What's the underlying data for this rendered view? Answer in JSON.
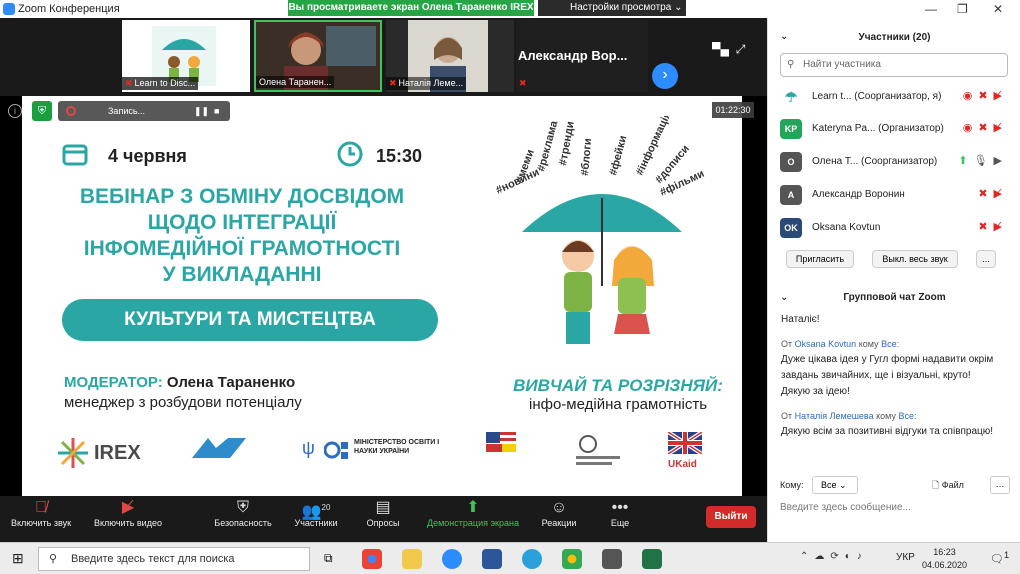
{
  "window": {
    "title": "Zoom Конференция"
  },
  "share_banner": "Вы просматриваете экран  Олена Тараненко IREX",
  "view_options": "Настройки просмотра",
  "gallery": [
    {
      "name": "Learn to Disc..."
    },
    {
      "name": "Олена Таранен..."
    },
    {
      "name": "Наталія Лемe..."
    },
    {
      "name": "Александр  Вор..."
    }
  ],
  "recording": {
    "label": "Запись...",
    "time": "01:22:30"
  },
  "slide": {
    "date": "4 червня",
    "time": "15:30",
    "title_lines": [
      "ВЕБІНАР З ОБМІНУ ДОСВІДОМ",
      "ЩОДО ІНТЕГРАЦІЇ",
      "ІНФОМЕДІЙНОЇ ГРАМОТНОСТІ",
      "У ВИКЛАДАННІ"
    ],
    "pill": "КУЛЬТУРИ ТА МИСТЕЦТВА",
    "moderator_label": "МОДЕРАТОР:",
    "moderator_name": "Олена Тараненко",
    "moderator_role": "менеджер з розбудови потенціалу",
    "slogan_1": "ВИВЧАЙ ТА РОЗРІЗНЯЙ:",
    "slogan_2": "інфо-медійна грамотність",
    "hashtags": [
      "#новини",
      "#меми",
      "#реклама",
      "#тренди",
      "#блоги",
      "#фейки",
      "#інформація",
      "#дописи",
      "#фільми"
    ],
    "logos": {
      "irex": "IREX",
      "mon": "МІНІСТЕРСТВО ОСВІТИ І НАУКИ УКРАЇНИ",
      "ukaid": "UKaid"
    }
  },
  "toolbar": [
    {
      "label": "Включить звук"
    },
    {
      "label": "Включить видео"
    },
    {
      "label": "Безопасность"
    },
    {
      "label": "Участники",
      "count": "20"
    },
    {
      "label": "Опросы"
    },
    {
      "label": "Демонстрация экрана"
    },
    {
      "label": "Реакции"
    },
    {
      "label": "Еще"
    }
  ],
  "leave": "Выйти",
  "panel": {
    "participants_title": "Участники (20)",
    "search_placeholder": "Найти участника",
    "participants": [
      {
        "initials": "",
        "name": "Learn t...",
        "role": "(Соорганизатор, я)",
        "color": "#ffffff"
      },
      {
        "initials": "KP",
        "name": "Kateryna Pa...",
        "role": "(Организатор)",
        "color": "#23a55a"
      },
      {
        "initials": "О",
        "name": "Олена Т...",
        "role": "(Соорганизатор)",
        "color": "#555555"
      },
      {
        "initials": "А",
        "name": "Александр Воронин",
        "role": "",
        "color": "#555555"
      },
      {
        "initials": "OK",
        "name": "Oksana Kovtun",
        "role": "",
        "color": "#2b4a78"
      }
    ],
    "invite": "Пригласить",
    "mute_all": "Выкл. весь звук",
    "more": "...",
    "chat_title": "Групповой чат Zoom",
    "messages": [
      {
        "from": "",
        "to": "",
        "text": "Наталіє!"
      },
      {
        "from": "Oksana Kovtun",
        "to": "Все:",
        "text": "Дуже цікава ідея у Гугл формі надавити окрім завдань звичайних, ще і візуальні, круто! Дякую за ідею!"
      },
      {
        "from": "Наталія Лемешева",
        "to": "Все:",
        "text": "Дякую всім за позитивні відгуки та співпрацю!"
      }
    ],
    "chat_from_label": "От",
    "chat_to_label": "кому",
    "to_label": "Кому:",
    "to_value": "Все",
    "file": "Файл",
    "input_placeholder": "Введите здесь сообщение..."
  },
  "taskbar": {
    "search": "Введите здесь текст для поиска",
    "lang": "УКР",
    "time": "16:23",
    "date": "04.06.2020",
    "notif": "1"
  },
  "colors": {
    "teal": "#2aa7a5",
    "zoom_blue": "#2d8cff",
    "green": "#26a545",
    "red": "#d32a2a"
  }
}
